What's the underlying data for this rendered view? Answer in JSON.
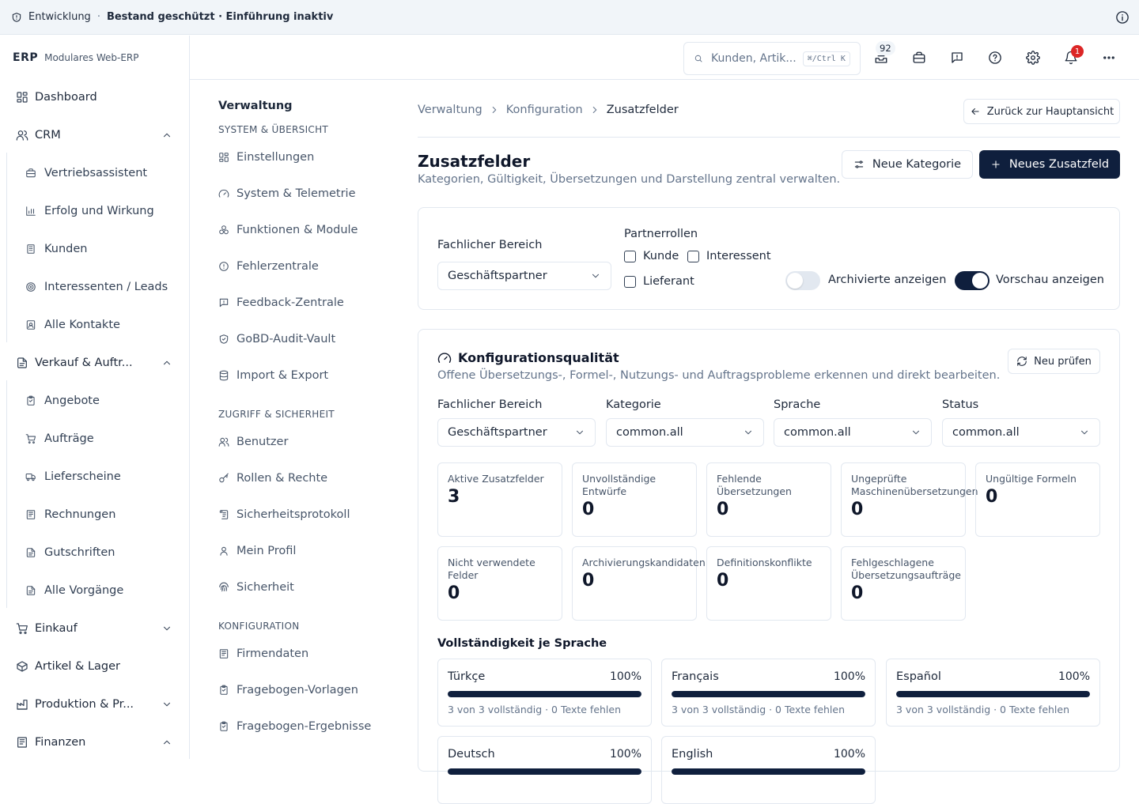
{
  "banner": {
    "env": "Entwicklung",
    "separator": "·",
    "status": "Bestand geschützt · Einführung inaktiv"
  },
  "brand": {
    "name": "ERP",
    "tagline": "Modulares Web-ERP"
  },
  "sidebar": {
    "dashboard": "Dashboard",
    "crm": "CRM",
    "crm_items": [
      "Vertriebsassistent",
      "Erfolg und Wirkung",
      "Kunden",
      "Interessenten / Leads",
      "Alle Kontakte"
    ],
    "sales": "Verkauf & Auftr...",
    "sales_items": [
      "Angebote",
      "Aufträge",
      "Lieferscheine",
      "Rechnungen",
      "Gutschriften",
      "Alle Vorgänge"
    ],
    "purchase": "Einkauf",
    "stock": "Artikel & Lager",
    "production": "Produktion & Pr...",
    "finance": "Finanzen"
  },
  "header": {
    "search_placeholder": "Kunden, Artik...",
    "shortcut": "⌘/Ctrl K",
    "queue_count": "92",
    "notifications": "1"
  },
  "settings_nav": {
    "title": "Verwaltung",
    "group1": "SYSTEM & ÜBERSICHT",
    "group1_items": [
      "Einstellungen",
      "System & Telemetrie",
      "Funktionen & Module",
      "Fehlerzentrale",
      "Feedback-Zentrale",
      "GoBD-Audit-Vault",
      "Import & Export"
    ],
    "group2": "ZUGRIFF & SICHERHEIT",
    "group2_items": [
      "Benutzer",
      "Rollen & Rechte",
      "Sicherheitsprotokoll",
      "Mein Profil",
      "Sicherheit"
    ],
    "group3": "KONFIGURATION",
    "group3_items": [
      "Firmendaten",
      "Fragebogen-Vorlagen",
      "Fragebogen-Ergebnisse"
    ]
  },
  "breadcrumb": [
    "Verwaltung",
    "Konfiguration",
    "Zusatzfelder"
  ],
  "back_button": "Zurück zur Hauptansicht",
  "page": {
    "title": "Zusatzfelder",
    "subtitle": "Kategorien, Gültigkeit, Übersetzungen und Darstellung zentral verwalten.",
    "new_category": "Neue Kategorie",
    "new_field": "Neues Zusatzfeld"
  },
  "filters": {
    "area_label": "Fachlicher Bereich",
    "area_value": "Geschäftspartner",
    "roles_label": "Partnerrollen",
    "roles": [
      "Kunde",
      "Interessent",
      "Lieferant"
    ],
    "show_archived": "Archivierte anzeigen",
    "show_archived_on": false,
    "show_preview": "Vorschau anzeigen",
    "show_preview_on": true
  },
  "quality": {
    "title": "Konfigurationsqualität",
    "subtitle": "Offene Übersetzungs-, Formel-, Nutzungs- und Auftragsprobleme erkennen und direkt bearbeiten.",
    "recheck": "Neu prüfen",
    "filters": [
      {
        "label": "Fachlicher Bereich",
        "value": "Geschäftspartner"
      },
      {
        "label": "Kategorie",
        "value": "common.all"
      },
      {
        "label": "Sprache",
        "value": "common.all"
      },
      {
        "label": "Status",
        "value": "common.all"
      }
    ],
    "metrics": [
      {
        "label": "Aktive Zusatzfelder",
        "value": "3"
      },
      {
        "label": "Unvollständige\nEntwürfe",
        "value": "0"
      },
      {
        "label": "Fehlende\nÜbersetzungen",
        "value": "0"
      },
      {
        "label": "Ungeprüfte\nMaschinenübersetzungen",
        "value": "0"
      },
      {
        "label": "Ungültige Formeln",
        "value": "0"
      },
      {
        "label": "Nicht verwendete\nFelder",
        "value": "0"
      },
      {
        "label": "Archivierungskandidaten",
        "value": "0"
      },
      {
        "label": "Definitionskonflikte",
        "value": "0"
      },
      {
        "label": "Fehlgeschlagene\nÜbersetzungsaufträge",
        "value": "0"
      }
    ],
    "completeness_title": "Vollständigkeit je Sprache",
    "languages": [
      {
        "name": "Türkçe",
        "percent": "100%",
        "progress": 1.0,
        "detail": "3 von 3 vollständig · 0 Texte fehlen"
      },
      {
        "name": "Français",
        "percent": "100%",
        "progress": 1.0,
        "detail": "3 von 3 vollständig · 0 Texte fehlen"
      },
      {
        "name": "Español",
        "percent": "100%",
        "progress": 1.0,
        "detail": "3 von 3 vollständig · 0 Texte fehlen"
      },
      {
        "name": "Deutsch",
        "percent": "100%",
        "progress": 1.0,
        "detail": ""
      },
      {
        "name": "English",
        "percent": "100%",
        "progress": 1.0,
        "detail": ""
      }
    ]
  }
}
